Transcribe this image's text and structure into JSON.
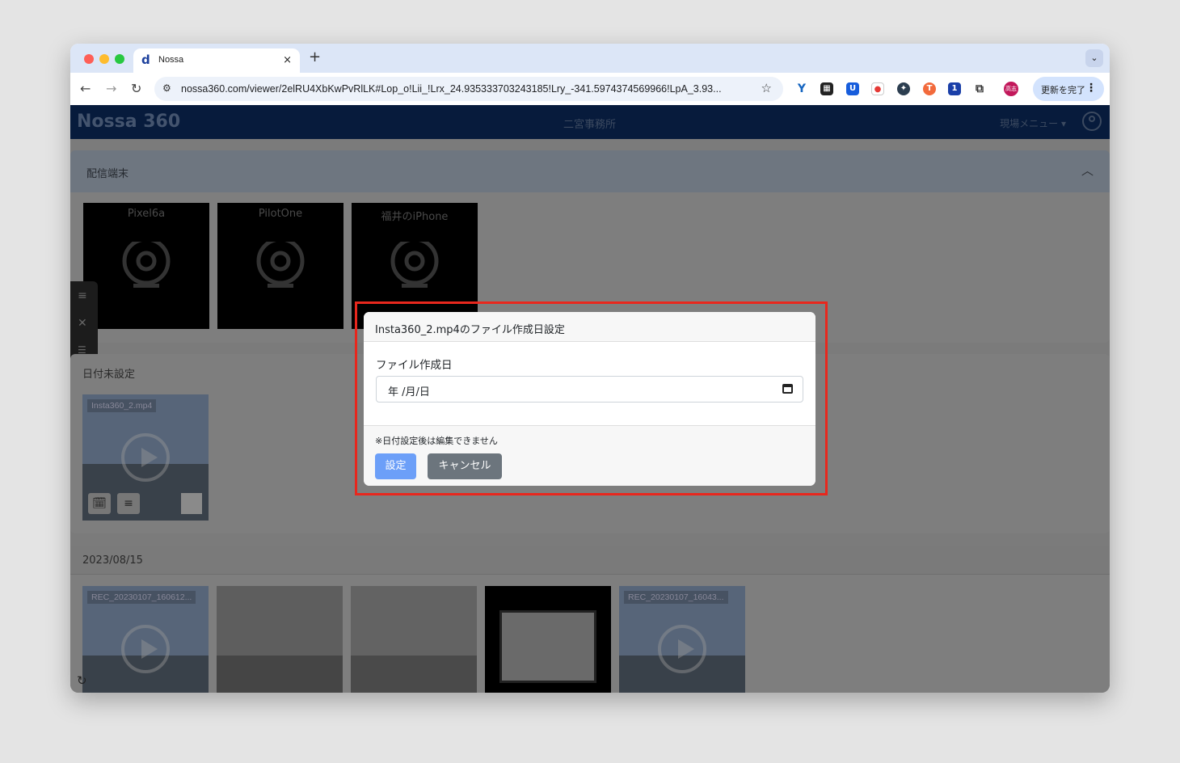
{
  "browser": {
    "tab_title": "Nossa",
    "tab_close": "×",
    "new_tab": "+",
    "url": "nossa360.com/viewer/2elRU4XbKwPvRlLK#Lop_o!Lii_!Lrx_24.935333703243185!Lry_-341.5974374569966!LpA_3.93...",
    "profile_button": "更新を完了",
    "profile_avatar": "高志"
  },
  "app": {
    "logo": "Nossa 360",
    "title": "二宮事務所",
    "menu": "現場メニュー ▾"
  },
  "devices_section": {
    "title": "配信端末",
    "devices": [
      {
        "name": "Pixel6a"
      },
      {
        "name": "PilotOne"
      },
      {
        "name": "福井のiPhone"
      }
    ]
  },
  "undated_section": {
    "title": "日付未設定",
    "items": [
      {
        "label": "Insta360_2.mp4"
      }
    ]
  },
  "dated_section": {
    "title": "2023/08/15",
    "items": [
      {
        "label": "REC_20230107_160612..."
      },
      {
        "label": ""
      },
      {
        "label": ""
      },
      {
        "label": ""
      },
      {
        "label": "REC_20230107_16043..."
      }
    ]
  },
  "modal": {
    "title": "Insta360_2.mp4のファイル作成日設定",
    "field_label": "ファイル作成日",
    "date_placeholder": "年 /月/日",
    "note": "※日付設定後は編集できません",
    "set_button": "設定",
    "cancel_button": "キャンセル"
  },
  "colors": {
    "highlight": "#e8271d",
    "primary_button": "#6c9ff8",
    "secondary_button": "#6c757d",
    "app_bar": "#071b3c"
  }
}
